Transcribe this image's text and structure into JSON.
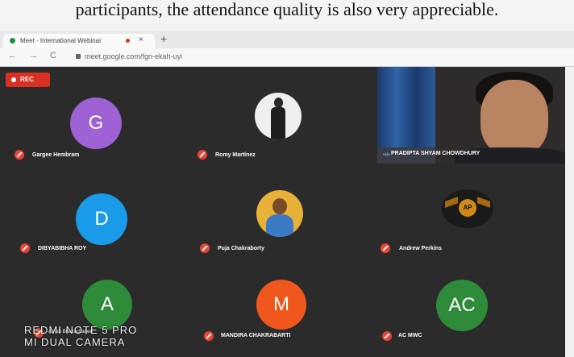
{
  "caption": "participants, the attendance quality is also very appreciable.",
  "browser": {
    "tab_title": "Meet - International Webinar",
    "tab_close": "×",
    "new_tab": "+",
    "url": "meet.google.com/fgn-ekah-uyi",
    "back": "←",
    "forward": "→",
    "reload": "C"
  },
  "meet": {
    "rec_label": "REC",
    "participants": [
      {
        "name": "Gargee Hembram",
        "initial": "G",
        "color": "#9e62d4"
      },
      {
        "name": "Romy Martínez",
        "initial": "",
        "color": "#ffffff"
      },
      {
        "name": "DIBYABIBHA ROY",
        "initial": "D",
        "color": "#1a9bea"
      },
      {
        "name": "Puja Chakraborty",
        "initial": "",
        "color": "#e8b23a"
      },
      {
        "name": "Andrew Perkins",
        "initial": "",
        "color": "#d08a18"
      },
      {
        "name": "Arnab Bhattacharjee",
        "initial": "A",
        "color": "#2e8b3a"
      },
      {
        "name": "MANDIRA CHAKRABARTI",
        "initial": "M",
        "color": "#f0571c"
      },
      {
        "name": "AC MWC",
        "initial": "AC",
        "color": "#2e8b3a"
      }
    ],
    "video_participant": "PRADIPTA SHYAM CHOWDHURY"
  },
  "watermark": {
    "line1": "REDMI NOTE 5 PRO",
    "line2": "MI DUAL CAMERA"
  },
  "colors": {
    "mute_red": "#ea4335",
    "rec_red": "#d93025",
    "meet_bg": "#2b2b2b"
  }
}
